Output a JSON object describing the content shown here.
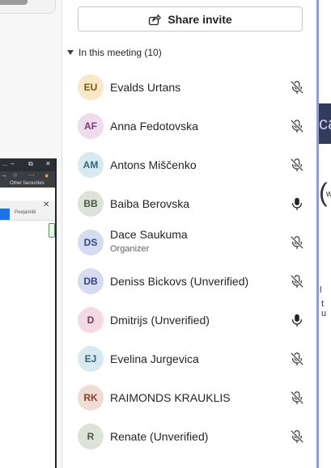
{
  "panel": {
    "share_invite_label": "Share invite",
    "section_title": "In this meeting (10)"
  },
  "participants": [
    {
      "initials": "EU",
      "name": "Evalds Urtans",
      "role": "",
      "muted": true,
      "avatar_bg": "#f7e8c6",
      "avatar_fg": "#7a5a16"
    },
    {
      "initials": "AF",
      "name": "Anna Fedotovska",
      "role": "",
      "muted": true,
      "avatar_bg": "#eddcec",
      "avatar_fg": "#7a3a74"
    },
    {
      "initials": "AM",
      "name": "Antons Miščenko",
      "role": "",
      "muted": true,
      "avatar_bg": "#d8eaf0",
      "avatar_fg": "#2a6a7a"
    },
    {
      "initials": "BB",
      "name": "Baiba Berovska",
      "role": "",
      "muted": false,
      "avatar_bg": "#dde3d9",
      "avatar_fg": "#4a5a44"
    },
    {
      "initials": "DS",
      "name": "Dace Saukuma",
      "role": "Organizer",
      "muted": true,
      "avatar_bg": "#d5dcef",
      "avatar_fg": "#34467e"
    },
    {
      "initials": "DB",
      "name": "Deniss Bickovs (Unverified)",
      "role": "",
      "muted": true,
      "avatar_bg": "#d5dcef",
      "avatar_fg": "#34467e"
    },
    {
      "initials": "D",
      "name": "Dmitrijs (Unverified)",
      "role": "",
      "muted": false,
      "avatar_bg": "#f3d9e4",
      "avatar_fg": "#8a2f58"
    },
    {
      "initials": "EJ",
      "name": "Evelina Jurgevica",
      "role": "",
      "muted": true,
      "avatar_bg": "#d8eaf0",
      "avatar_fg": "#2a6a7a"
    },
    {
      "initials": "RK",
      "name": "RAIMONDS KRAUKLIS",
      "role": "",
      "muted": true,
      "avatar_bg": "#f1dcd3",
      "avatar_fg": "#8a3f24"
    },
    {
      "initials": "R",
      "name": "Renate (Unverified)",
      "role": "",
      "muted": true,
      "avatar_bg": "#dde3d9",
      "avatar_fg": "#4a5a44"
    }
  ],
  "background": {
    "bookmark_label": "Other favourites",
    "tab_fragment": "Peejamibi",
    "right_fragment_top": "ca",
    "right_fragment_mid": "w",
    "right_fragment_bottom": "t u",
    "right_fragment_line": "l"
  }
}
